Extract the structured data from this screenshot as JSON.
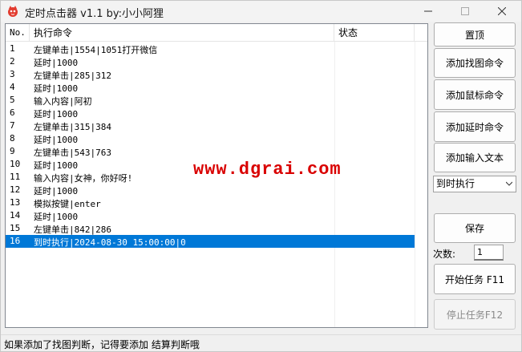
{
  "window": {
    "title": "定时点击器 v1.1 by:小小阿狸"
  },
  "list": {
    "columns": {
      "no": "No.",
      "command": "执行命令",
      "status": "状态"
    },
    "rows": [
      {
        "no": "1",
        "command": "左键单击|1554|1051打开微信",
        "status": ""
      },
      {
        "no": "2",
        "command": "延时|1000",
        "status": ""
      },
      {
        "no": "3",
        "command": "左键单击|285|312",
        "status": ""
      },
      {
        "no": "4",
        "command": "延时|1000",
        "status": ""
      },
      {
        "no": "5",
        "command": "输入内容|阿初",
        "status": ""
      },
      {
        "no": "6",
        "command": "延时|1000",
        "status": ""
      },
      {
        "no": "7",
        "command": "左键单击|315|384",
        "status": ""
      },
      {
        "no": "8",
        "command": "延时|1000",
        "status": ""
      },
      {
        "no": "9",
        "command": "左键单击|543|763",
        "status": ""
      },
      {
        "no": "10",
        "command": "延时|1000",
        "status": ""
      },
      {
        "no": "11",
        "command": "输入内容|女神，你好呀!",
        "status": ""
      },
      {
        "no": "12",
        "command": "延时|1000",
        "status": ""
      },
      {
        "no": "13",
        "command": "模拟按键|enter",
        "status": ""
      },
      {
        "no": "14",
        "command": "延时|1000",
        "status": ""
      },
      {
        "no": "15",
        "command": "左键单击|842|286",
        "status": ""
      },
      {
        "no": "16",
        "command": "到时执行|2024-08-30 15:00:00|0",
        "status": "",
        "selected": true
      }
    ]
  },
  "watermark": "www.dgrai.com",
  "side": {
    "pin_label": "置顶",
    "add_find_image_label": "添加找图命令",
    "add_mouse_label": "添加鼠标命令",
    "add_delay_label": "添加延时命令",
    "add_input_label": "添加输入文本",
    "mode_select_value": "到时执行",
    "save_label": "保存",
    "count_label": "次数:",
    "count_value": "1",
    "start_label": "开始任务 F11",
    "stop_label": "停止任务F12"
  },
  "statusbar": {
    "text": "如果添加了找图判断，记得要添加 结算判断哦"
  },
  "colors": {
    "selection": "#0078d7",
    "watermark": "#d90000",
    "list_border": "#828790"
  },
  "icons": {
    "app": "app-icon",
    "minimize": "minimize-icon",
    "maximize": "maximize-icon",
    "close": "close-icon",
    "dropdown": "chevron-down-icon"
  }
}
